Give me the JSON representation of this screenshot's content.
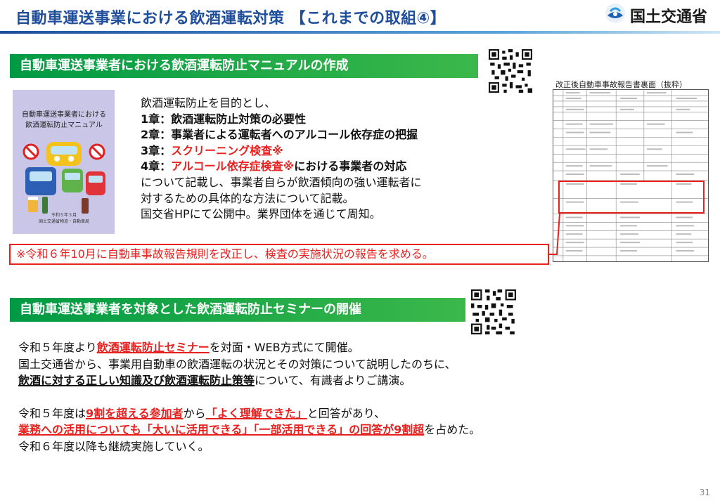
{
  "header": {
    "title": "自動車運送事業における飲酒運転対策 【これまでの取組④】",
    "logo_text": "国土交通省"
  },
  "section1": {
    "heading": "自動車運送事業者における飲酒運転防止マニュアルの作成",
    "manual_cover": {
      "title_line1": "自動車運送事業者における",
      "title_line2": "飲酒運転防止マニュアル",
      "foot_line1": "令和５年３月",
      "foot_line2": "国土交通省物流・自動車局"
    },
    "lines": {
      "l1": "飲酒運転防止を目的とし、",
      "l2": "1章：飲酒運転防止対策の必要性",
      "l3": "2章：事業者による運転者へのアルコール依存症の把握",
      "l4a": "3章：",
      "l4b": "スクリーニング検査※",
      "l5a": "4章：",
      "l5b": "アルコール依存症検査※",
      "l5c": "における事業者の対応",
      "l6": "について記載し、事業者自らが飲酒傾向の強い運転者に",
      "l7": "対するための具体的な方法について記載。",
      "l8": "国交省HPにて公開中。業界団体を通じて周知。"
    },
    "note": "※令和６年10月に自動車事故報告規則を改正し、検査の実施状況の報告を求める。",
    "form_title": "改正後自動車事故報告書裏面（抜粋）"
  },
  "section2": {
    "heading": "自動車運送事業者を対象とした飲酒運転防止セミナーの開催",
    "p1a": "令和５年度より",
    "p1b": "飲酒運転防止セミナー",
    "p1c": "を対面・WEB方式にて開催。",
    "p2": "国土交通省から、事業用自動車の飲酒運転の状況とその対策について説明したのちに、",
    "p3a": "飲酒に対する正しい知識及び飲酒運転防止策等",
    "p3b": "について、有識者よりご講演。",
    "p4a": "令和５年度は",
    "p4b": "9割を超える参加者",
    "p4c": "から",
    "p4d": "「よく理解できた」",
    "p4e": "と回答があり、",
    "p5a": "業務への活用についても「大いに活用できる」「一部活用できる」の回答が9割超",
    "p5b": "を占めた。",
    "p6": "令和６年度以降も継続実施していく。"
  },
  "page_number": "31"
}
